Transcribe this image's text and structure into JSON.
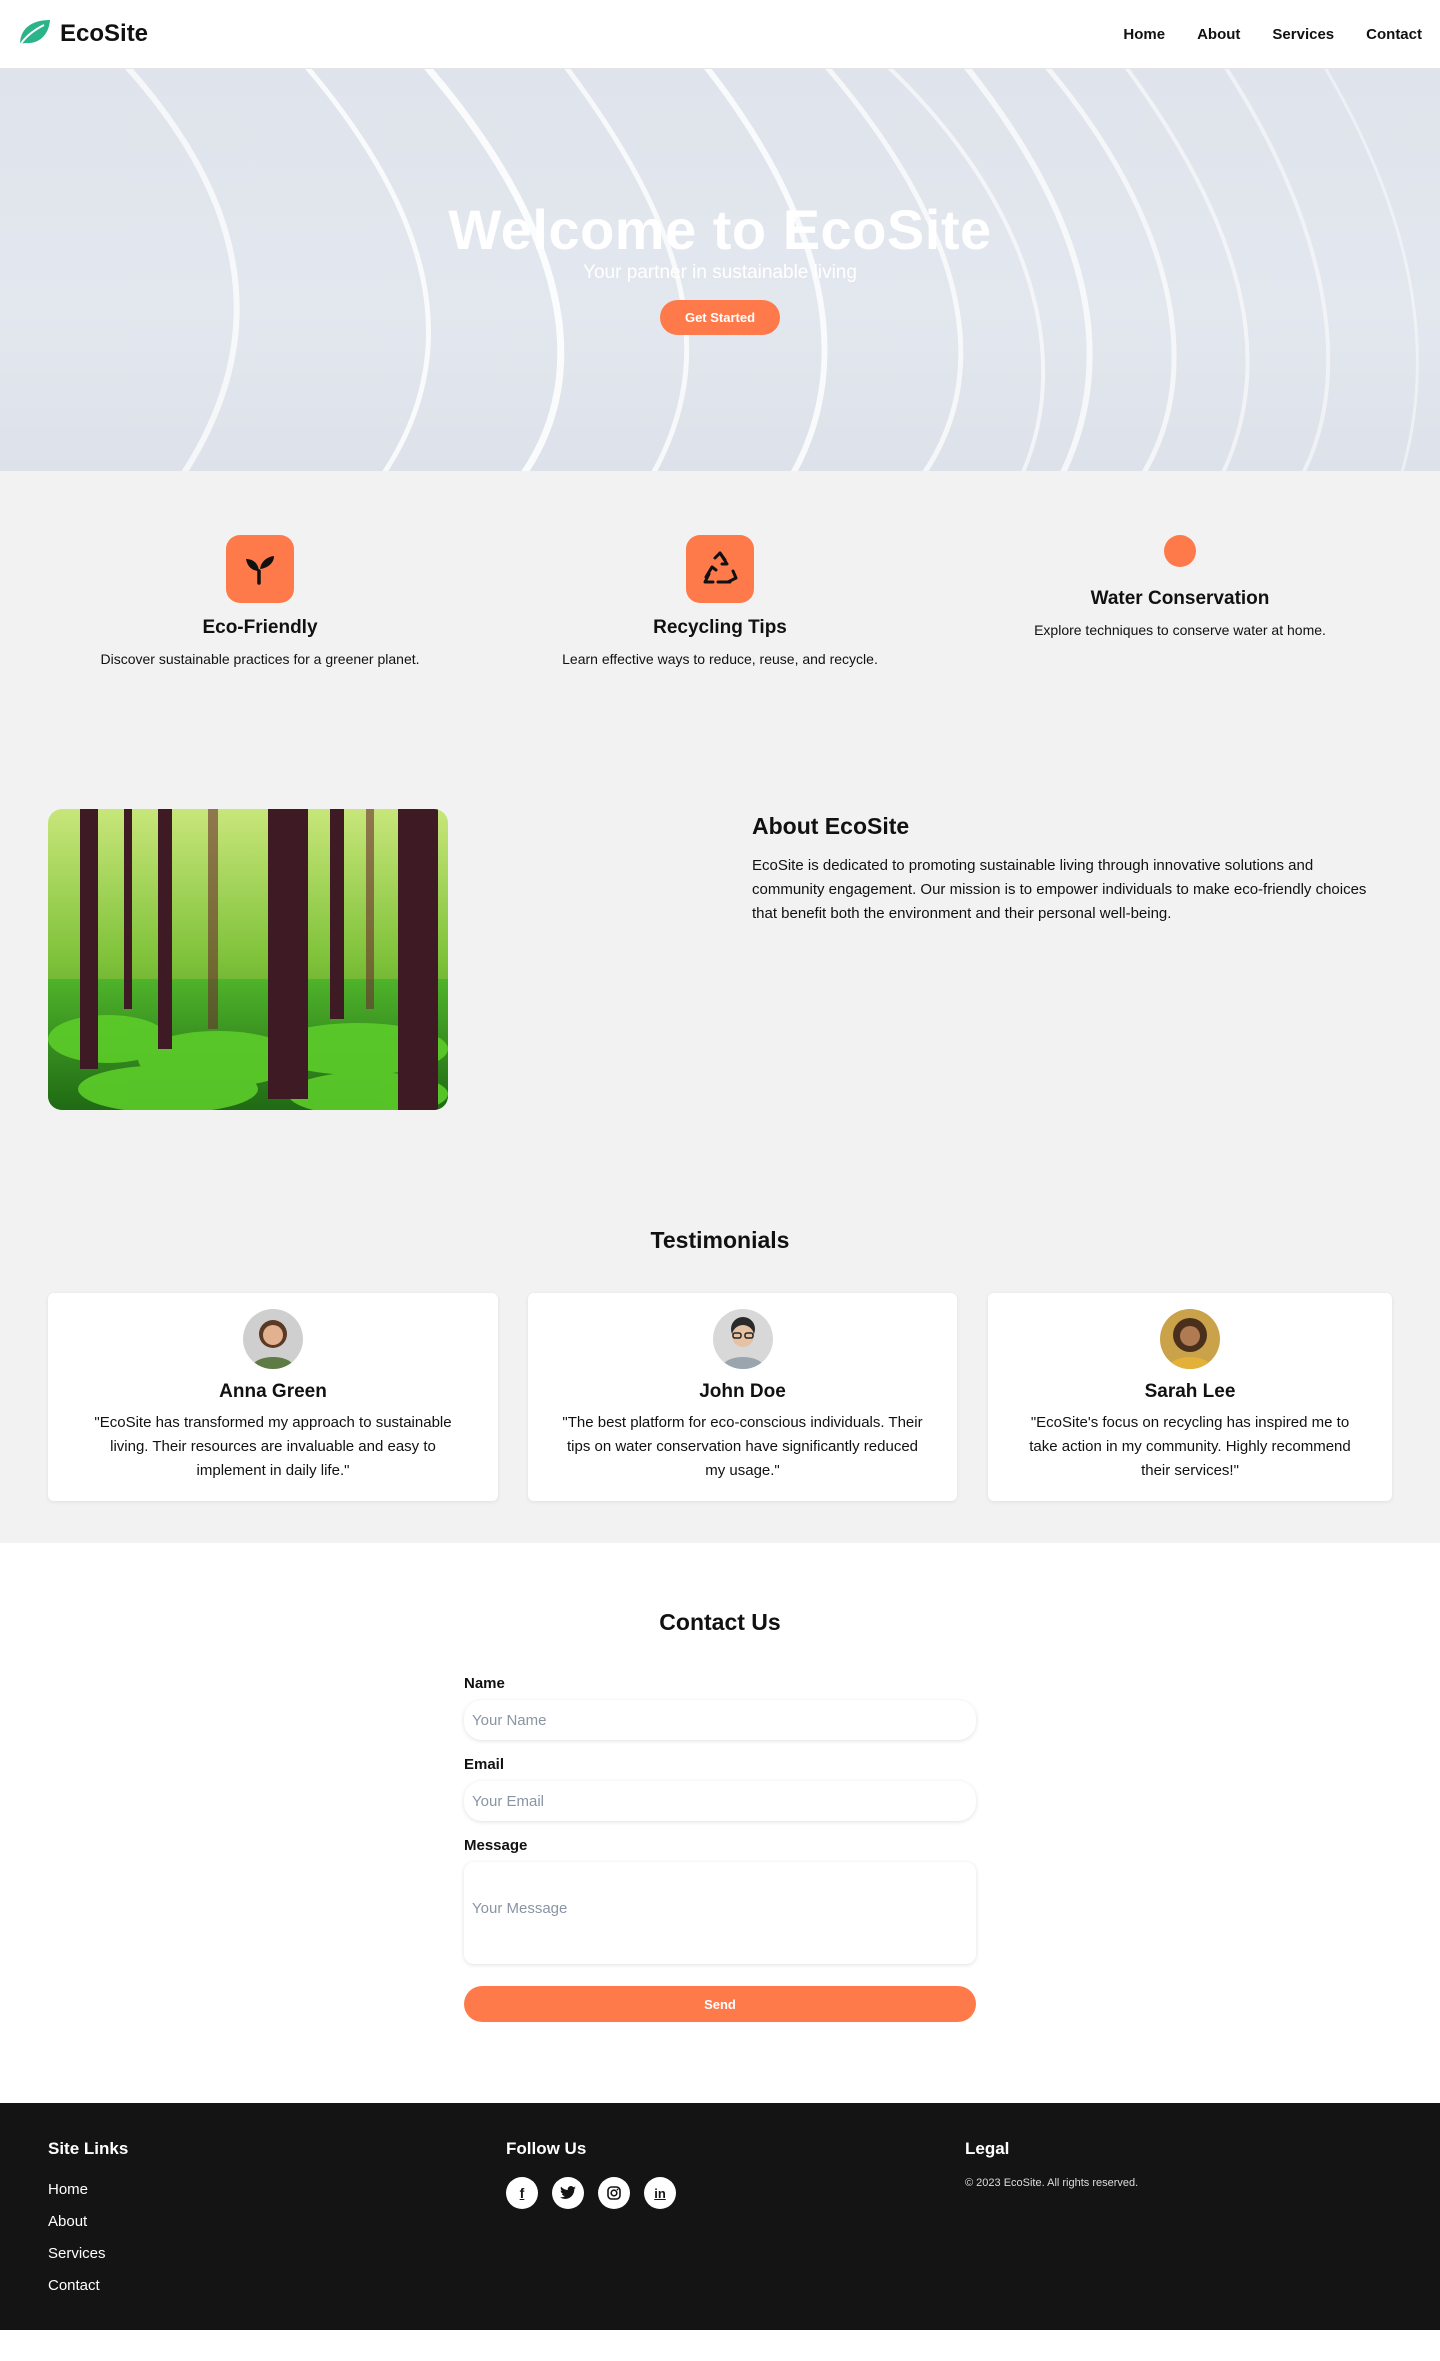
{
  "nav": {
    "brand": "EcoSite",
    "links": [
      "Home",
      "About",
      "Services",
      "Contact"
    ]
  },
  "hero": {
    "title": "Welcome to EcoSite",
    "subtitle": "Your partner in sustainable living",
    "cta": "Get Started"
  },
  "features": [
    {
      "icon": "sprout-icon",
      "title": "Eco-Friendly",
      "text": "Discover sustainable practices for a greener planet."
    },
    {
      "icon": "recycle-icon",
      "title": "Recycling Tips",
      "text": "Learn effective ways to reduce, reuse, and recycle."
    },
    {
      "icon": "orange-dot-icon",
      "title": "Water Conservation",
      "text": "Explore techniques to conserve water at home."
    }
  ],
  "about": {
    "title": "About EcoSite",
    "body": "EcoSite is dedicated to promoting sustainable living through innovative solutions and community engagement. Our mission is to empower individuals to make eco-friendly choices that benefit both the environment and their personal well-being."
  },
  "testimonials": {
    "title": "Testimonials",
    "items": [
      {
        "name": "Anna Green",
        "quote": "\"EcoSite has transformed my approach to sustainable living. Their resources are invaluable and easy to implement in daily life.\""
      },
      {
        "name": "John Doe",
        "quote": "\"The best platform for eco-conscious individuals. Their tips on water conservation have significantly reduced my usage.\""
      },
      {
        "name": "Sarah Lee",
        "quote": "\"EcoSite's focus on recycling has inspired me to take action in my community. Highly recommend their services!\""
      }
    ]
  },
  "contact": {
    "title": "Contact Us",
    "name_label": "Name",
    "name_placeholder": "Your Name",
    "email_label": "Email",
    "email_placeholder": "Your Email",
    "message_label": "Message",
    "message_placeholder": "Your Message",
    "send_label": "Send"
  },
  "footer": {
    "site_links_title": "Site Links",
    "site_links": [
      "Home",
      "About",
      "Services",
      "Contact"
    ],
    "follow_title": "Follow Us",
    "socials": [
      "facebook-icon",
      "twitter-icon",
      "instagram-icon",
      "linkedin-icon"
    ],
    "legal_title": "Legal",
    "copyright": "© 2023 EcoSite. All rights reserved."
  },
  "colors": {
    "accent": "#ff7a4a",
    "logo_green": "#2bb48a",
    "footer_bg": "#141414",
    "section_bg": "#f2f2f2"
  }
}
